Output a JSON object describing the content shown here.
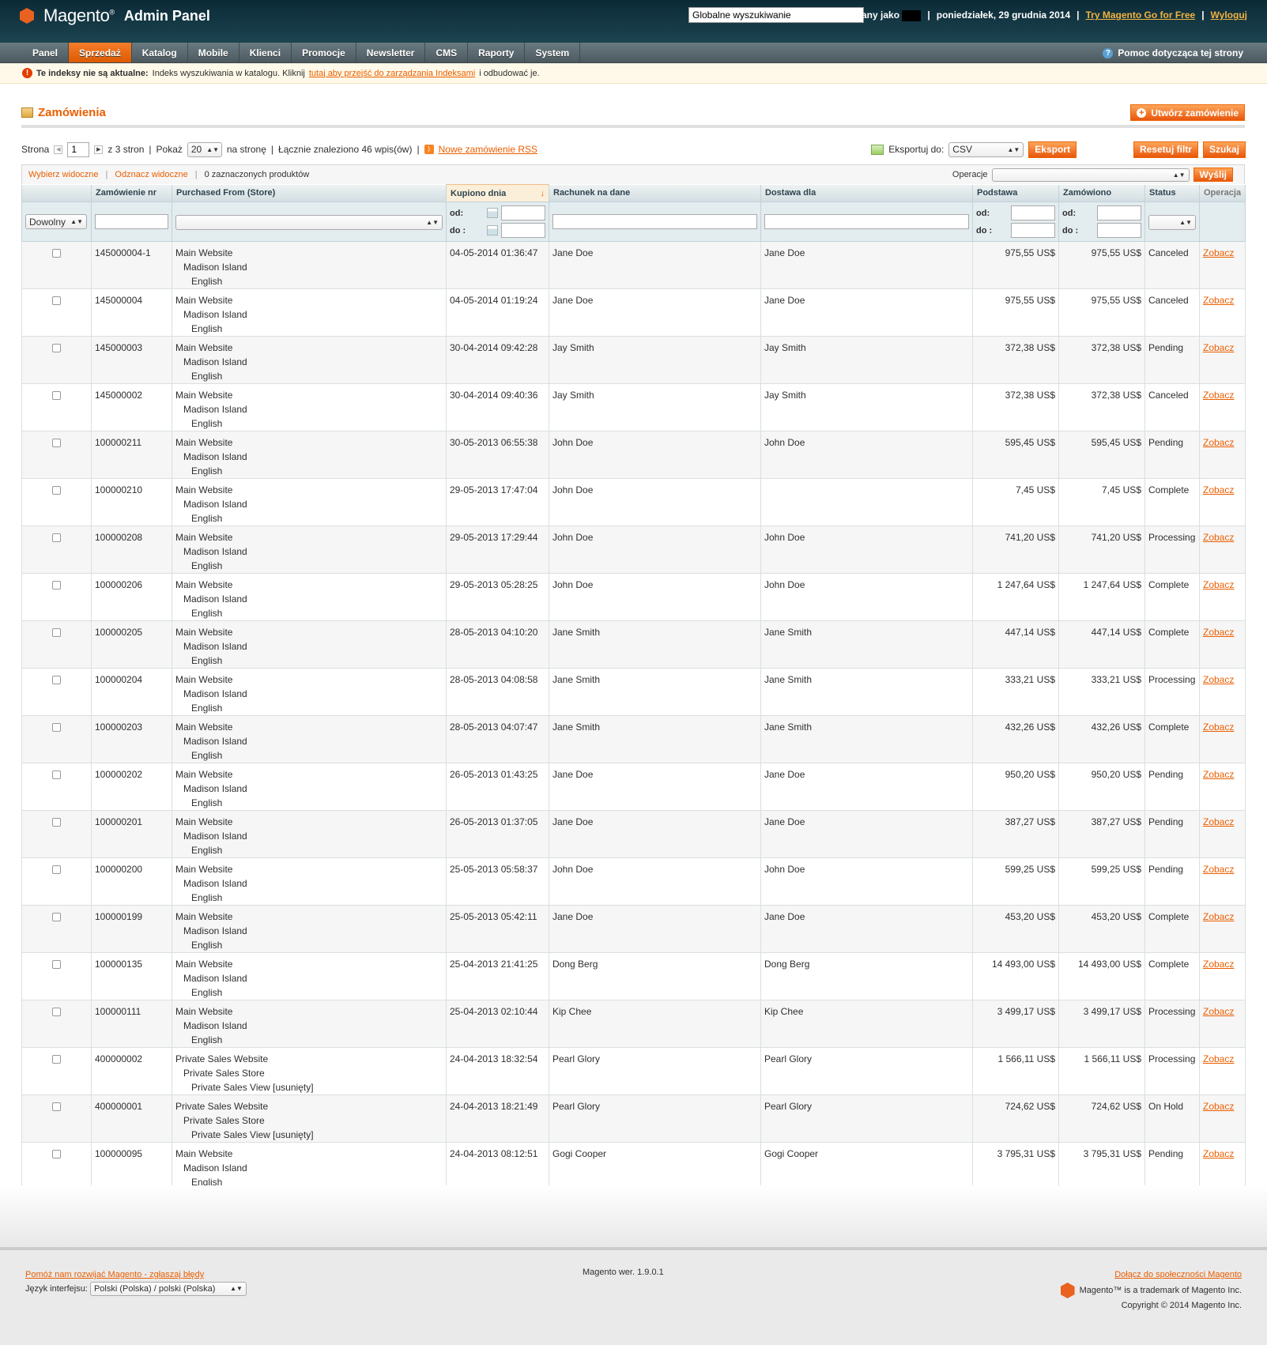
{
  "header": {
    "logo": "Magento",
    "logo_tm": "®",
    "panel": "Admin Panel",
    "search_value": "Globalne wyszukiwanie",
    "logged_in": "Zalogowany jako",
    "date": "poniedziałek, 29 grudnia 2014",
    "try_link": "Try Magento Go for Free",
    "logout": "Wyloguj"
  },
  "nav": {
    "items": [
      "Panel",
      "Sprzedaż",
      "Katalog",
      "Mobile",
      "Klienci",
      "Promocje",
      "Newsletter",
      "CMS",
      "Raporty",
      "System"
    ],
    "active": "Sprzedaż",
    "help": "Pomoc dotycząca tej strony"
  },
  "notice": {
    "bold": "Te indeksy nie są aktualne:",
    "text": "Indeks wyszukiwania w katalogu. Kliknij",
    "link": "tutaj aby przejść do zarządzania Indeksami",
    "after": "i odbudować je."
  },
  "page": {
    "title": "Zamówienia",
    "create_btn": "Utwórz zamówienie"
  },
  "pager": {
    "page_label": "Strona",
    "page": "1",
    "of_pages": "z 3 stron",
    "show_label": "Pokaż",
    "per_page": "20",
    "per_page_suffix": "na stronę",
    "found": "Łącznie znaleziono 46 wpis(ów)",
    "rss": "Nowe zamówienie RSS",
    "export_label": "Eksportuj do:",
    "export_format": "CSV",
    "export_btn": "Eksport",
    "reset_btn": "Resetuj filtr",
    "search_btn": "Szukaj"
  },
  "massaction": {
    "select_visible": "Wybierz widoczne",
    "unselect_visible": "Odznacz widoczne",
    "selected": "0 zaznaczonych produktów",
    "operations_label": "Operacje",
    "submit": "Wyślij"
  },
  "columns": [
    "Zamówienie nr",
    "Purchased From (Store)",
    "Kupiono dnia",
    "Rachunek na dane",
    "Dostawa dla",
    "Podstawa",
    "Zamówiono",
    "Status",
    "Operacja"
  ],
  "filters": {
    "any": "Dowolny",
    "from": "od:",
    "to": "do :"
  },
  "view_label": "Zobacz",
  "rows": [
    {
      "id": "145000004-1",
      "s1": "Main Website",
      "s2": "Madison Island",
      "s3": "English",
      "date": "04-05-2014 01:36:47",
      "bill": "Jane Doe",
      "ship": "Jane Doe",
      "base": "975,55 US$",
      "total": "975,55 US$",
      "status": "Canceled"
    },
    {
      "id": "145000004",
      "s1": "Main Website",
      "s2": "Madison Island",
      "s3": "English",
      "date": "04-05-2014 01:19:24",
      "bill": "Jane Doe",
      "ship": "Jane Doe",
      "base": "975,55 US$",
      "total": "975,55 US$",
      "status": "Canceled"
    },
    {
      "id": "145000003",
      "s1": "Main Website",
      "s2": "Madison Island",
      "s3": "English",
      "date": "30-04-2014 09:42:28",
      "bill": "Jay Smith",
      "ship": "Jay Smith",
      "base": "372,38 US$",
      "total": "372,38 US$",
      "status": "Pending"
    },
    {
      "id": "145000002",
      "s1": "Main Website",
      "s2": "Madison Island",
      "s3": "English",
      "date": "30-04-2014 09:40:36",
      "bill": "Jay Smith",
      "ship": "Jay Smith",
      "base": "372,38 US$",
      "total": "372,38 US$",
      "status": "Canceled"
    },
    {
      "id": "100000211",
      "s1": "Main Website",
      "s2": "Madison Island",
      "s3": "English",
      "date": "30-05-2013 06:55:38",
      "bill": "John Doe",
      "ship": "John Doe",
      "base": "595,45 US$",
      "total": "595,45 US$",
      "status": "Pending"
    },
    {
      "id": "100000210",
      "s1": "Main Website",
      "s2": "Madison Island",
      "s3": "English",
      "date": "29-05-2013 17:47:04",
      "bill": "John Doe",
      "ship": "",
      "base": "7,45 US$",
      "total": "7,45 US$",
      "status": "Complete"
    },
    {
      "id": "100000208",
      "s1": "Main Website",
      "s2": "Madison Island",
      "s3": "English",
      "date": "29-05-2013 17:29:44",
      "bill": "John Doe",
      "ship": "John Doe",
      "base": "741,20 US$",
      "total": "741,20 US$",
      "status": "Processing"
    },
    {
      "id": "100000206",
      "s1": "Main Website",
      "s2": "Madison Island",
      "s3": "English",
      "date": "29-05-2013 05:28:25",
      "bill": "John Doe",
      "ship": "John Doe",
      "base": "1 247,64 US$",
      "total": "1 247,64 US$",
      "status": "Complete"
    },
    {
      "id": "100000205",
      "s1": "Main Website",
      "s2": "Madison Island",
      "s3": "English",
      "date": "28-05-2013 04:10:20",
      "bill": "Jane Smith",
      "ship": "Jane Smith",
      "base": "447,14 US$",
      "total": "447,14 US$",
      "status": "Complete"
    },
    {
      "id": "100000204",
      "s1": "Main Website",
      "s2": "Madison Island",
      "s3": "English",
      "date": "28-05-2013 04:08:58",
      "bill": "Jane Smith",
      "ship": "Jane Smith",
      "base": "333,21 US$",
      "total": "333,21 US$",
      "status": "Processing"
    },
    {
      "id": "100000203",
      "s1": "Main Website",
      "s2": "Madison Island",
      "s3": "English",
      "date": "28-05-2013 04:07:47",
      "bill": "Jane Smith",
      "ship": "Jane Smith",
      "base": "432,26 US$",
      "total": "432,26 US$",
      "status": "Complete"
    },
    {
      "id": "100000202",
      "s1": "Main Website",
      "s2": "Madison Island",
      "s3": "English",
      "date": "26-05-2013 01:43:25",
      "bill": "Jane Doe",
      "ship": "Jane Doe",
      "base": "950,20 US$",
      "total": "950,20 US$",
      "status": "Pending"
    },
    {
      "id": "100000201",
      "s1": "Main Website",
      "s2": "Madison Island",
      "s3": "English",
      "date": "26-05-2013 01:37:05",
      "bill": "Jane Doe",
      "ship": "Jane Doe",
      "base": "387,27 US$",
      "total": "387,27 US$",
      "status": "Pending"
    },
    {
      "id": "100000200",
      "s1": "Main Website",
      "s2": "Madison Island",
      "s3": "English",
      "date": "25-05-2013 05:58:37",
      "bill": "John Doe",
      "ship": "John Doe",
      "base": "599,25 US$",
      "total": "599,25 US$",
      "status": "Pending"
    },
    {
      "id": "100000199",
      "s1": "Main Website",
      "s2": "Madison Island",
      "s3": "English",
      "date": "25-05-2013 05:42:11",
      "bill": "Jane Doe",
      "ship": "Jane Doe",
      "base": "453,20 US$",
      "total": "453,20 US$",
      "status": "Complete"
    },
    {
      "id": "100000135",
      "s1": "Main Website",
      "s2": "Madison Island",
      "s3": "English",
      "date": "25-04-2013 21:41:25",
      "bill": "Dong Berg",
      "ship": "Dong Berg",
      "base": "14 493,00 US$",
      "total": "14 493,00 US$",
      "status": "Complete"
    },
    {
      "id": "100000111",
      "s1": "Main Website",
      "s2": "Madison Island",
      "s3": "English",
      "date": "25-04-2013 02:10:44",
      "bill": "Kip Chee",
      "ship": "Kip Chee",
      "base": "3 499,17 US$",
      "total": "3 499,17 US$",
      "status": "Processing"
    },
    {
      "id": "400000002",
      "s1": "Private Sales Website",
      "s2": "Private Sales Store",
      "s3": "Private Sales View [usunięty]",
      "date": "24-04-2013 18:32:54",
      "bill": "Pearl Glory",
      "ship": "Pearl Glory",
      "base": "1 566,11 US$",
      "total": "1 566,11 US$",
      "status": "Processing"
    },
    {
      "id": "400000001",
      "s1": "Private Sales Website",
      "s2": "Private Sales Store",
      "s3": "Private Sales View [usunięty]",
      "date": "24-04-2013 18:21:49",
      "bill": "Pearl Glory",
      "ship": "Pearl Glory",
      "base": "724,62 US$",
      "total": "724,62 US$",
      "status": "On Hold"
    },
    {
      "id": "100000095",
      "s1": "Main Website",
      "s2": "Madison Island",
      "s3": "English",
      "date": "24-04-2013 08:12:51",
      "bill": "Gogi Cooper",
      "ship": "Gogi Cooper",
      "base": "3 795,31 US$",
      "total": "3 795,31 US$",
      "status": "Pending"
    }
  ],
  "footer": {
    "bug_link": "Pomóż nam rozwijać Magento - zgłaszaj błędy",
    "lang_label": "Język interfejsu:",
    "lang_value": "Polski (Polska) / polski (Polska)",
    "version": "Magento wer. 1.9.0.1",
    "community": "Dołącz do społeczności Magento",
    "trademark": "Magento™ is a trademark of Magento Inc.",
    "copyright": "Copyright © 2014 Magento Inc."
  }
}
